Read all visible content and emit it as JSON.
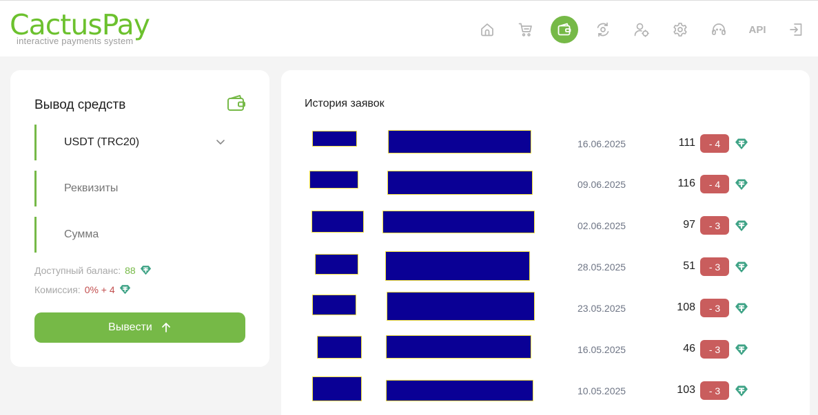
{
  "brand": {
    "name": "CactusPay",
    "tagline": "interactive payments system"
  },
  "nav": {
    "items": [
      {
        "icon": "home-icon"
      },
      {
        "icon": "cart-icon"
      },
      {
        "icon": "wallet-icon",
        "active": true
      },
      {
        "icon": "exchange-icon"
      },
      {
        "icon": "user-settings-icon"
      },
      {
        "icon": "gear-icon"
      },
      {
        "icon": "support-icon"
      },
      {
        "icon": "api-label",
        "label": "API"
      },
      {
        "icon": "logout-icon"
      }
    ]
  },
  "withdraw": {
    "title": "Вывод средств",
    "currency": "USDT (TRC20)",
    "details_placeholder": "Реквизиты",
    "amount_placeholder": "Сумма",
    "balance_label": "Доступный баланс:",
    "balance_value": "88",
    "fee_label": "Комиссия:",
    "fee_value": "0% + 4",
    "submit_label": "Вывести"
  },
  "history": {
    "title": "История заявок",
    "rows": [
      {
        "date": "16.06.2025",
        "amount": "111",
        "fee": "- 4"
      },
      {
        "date": "09.06.2025",
        "amount": "116",
        "fee": "- 4"
      },
      {
        "date": "02.06.2025",
        "amount": "97",
        "fee": "- 3"
      },
      {
        "date": "28.05.2025",
        "amount": "51",
        "fee": "- 3"
      },
      {
        "date": "23.05.2025",
        "amount": "108",
        "fee": "- 3"
      },
      {
        "date": "16.05.2025",
        "amount": "46",
        "fee": "- 3"
      },
      {
        "date": "10.05.2025",
        "amount": "103",
        "fee": "- 3"
      }
    ]
  },
  "colors": {
    "accent": "#76b947",
    "brand": "#6cc12e",
    "fee_badge": "#c95d5d",
    "token": "#3fa386",
    "redaction": "#0a0095"
  }
}
